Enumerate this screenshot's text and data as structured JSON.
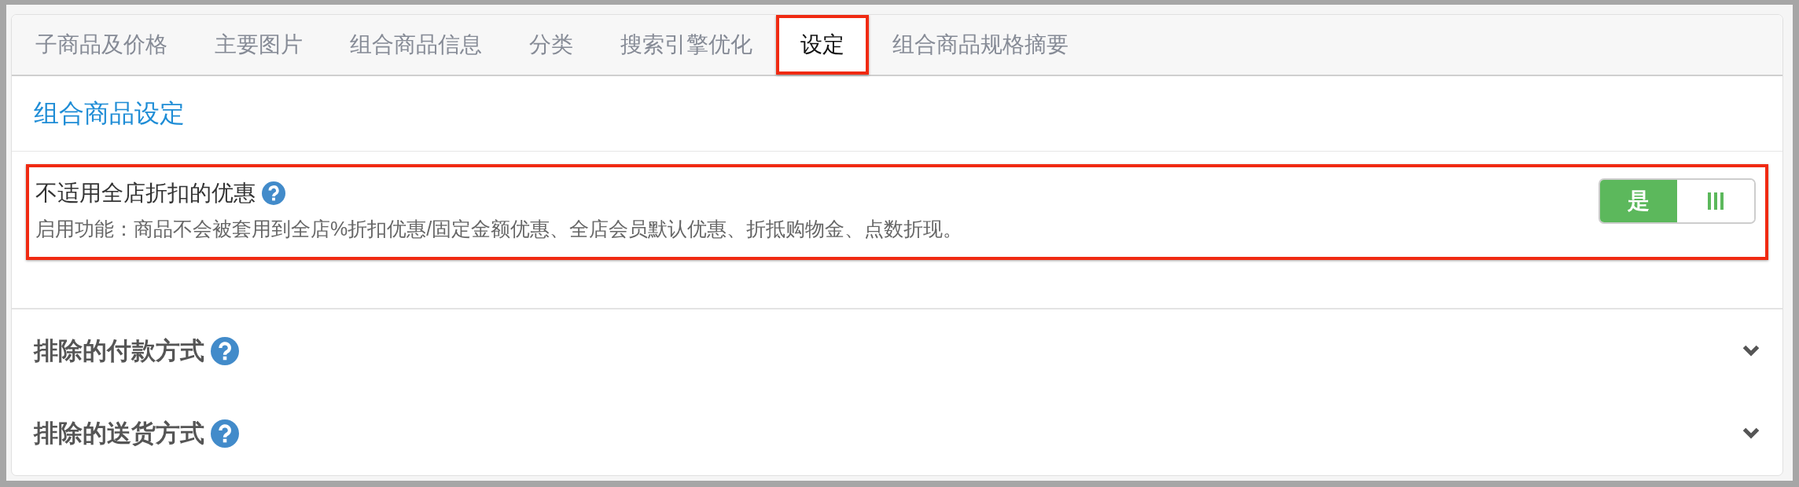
{
  "tabs": [
    {
      "label": "子商品及价格",
      "selected": false,
      "highlighted": false
    },
    {
      "label": "主要图片",
      "selected": false,
      "highlighted": false
    },
    {
      "label": "组合商品信息",
      "selected": false,
      "highlighted": false
    },
    {
      "label": "分类",
      "selected": false,
      "highlighted": false
    },
    {
      "label": "搜索引擎优化",
      "selected": false,
      "highlighted": false
    },
    {
      "label": "设定",
      "selected": true,
      "highlighted": true
    },
    {
      "label": "组合商品规格摘要",
      "selected": false,
      "highlighted": false
    }
  ],
  "section_title": "组合商品设定",
  "setting": {
    "title": "不适用全店折扣的优惠",
    "description": "启用功能：商品不会被套用到全店%折扣优惠/固定金额优惠、全店会员默认优惠、折抵购物金、点数折现。",
    "highlighted": true,
    "toggle": {
      "on": true,
      "label": "是"
    }
  },
  "collapsible_sections": [
    {
      "title": "排除的付款方式",
      "expanded": false
    },
    {
      "title": "排除的送货方式",
      "expanded": false
    }
  ]
}
